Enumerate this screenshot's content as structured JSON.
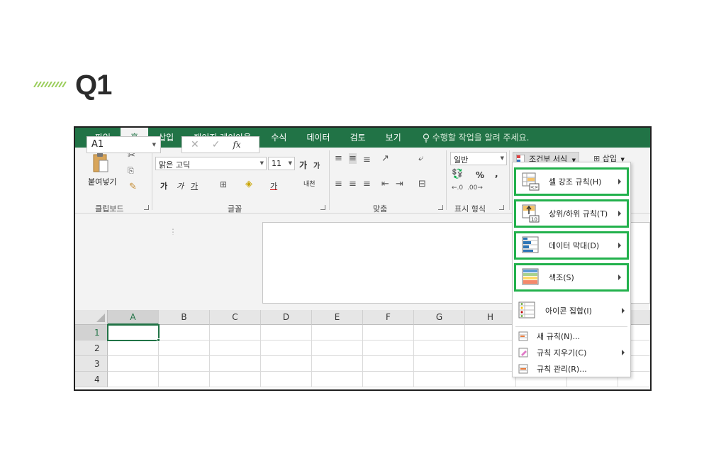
{
  "heading": {
    "title": "Q1"
  },
  "ribbon_tabs": [
    {
      "label": "파일"
    },
    {
      "label": "홈"
    },
    {
      "label": "삽입"
    },
    {
      "label": "페이지 레이아웃"
    },
    {
      "label": "수식"
    },
    {
      "label": "데이터"
    },
    {
      "label": "검토"
    },
    {
      "label": "보기"
    }
  ],
  "tell_me": "수행할 작업을 알려 주세요.",
  "clipboard": {
    "paste_label": "붙여넣기",
    "group_label": "클립보드"
  },
  "font": {
    "name": "맑은 고딕",
    "size": "11",
    "grow": "가",
    "shrink": "가",
    "bold": "가",
    "italic": "가",
    "underline": "가",
    "font_color": "가",
    "phonetic": "내천",
    "group_label": "글꼴"
  },
  "alignment": {
    "group_label": "맞춤"
  },
  "number": {
    "format": "일반",
    "percent": "%",
    "comma": ",",
    "group_label": "표시 형식"
  },
  "styles": {
    "conditional_formatting": "조건부 서식"
  },
  "cells": {
    "insert": "삽입"
  },
  "name_box": {
    "value": "A1"
  },
  "formula_bar": {
    "cancel": "✕",
    "enter": "✓",
    "fx": "fx"
  },
  "columns": [
    "A",
    "B",
    "C",
    "D",
    "E",
    "F",
    "G",
    "H"
  ],
  "rows": [
    "1",
    "2",
    "3",
    "4"
  ],
  "menu": {
    "items": [
      {
        "label": "셀 강조 규칙(H)",
        "highlighted": true,
        "submenu": true,
        "icon": "highlight-cells-rules-icon"
      },
      {
        "label": "상위/하위 규칙(T)",
        "highlighted": true,
        "submenu": true,
        "icon": "top-bottom-rules-icon",
        "icon_text": "10"
      },
      {
        "label": "데이터 막대(D)",
        "highlighted": true,
        "submenu": true,
        "icon": "data-bars-icon"
      },
      {
        "label": "색조(S)",
        "highlighted": true,
        "submenu": true,
        "icon": "color-scales-icon"
      },
      {
        "label": "아이콘 집합(I)",
        "highlighted": false,
        "submenu": true,
        "icon": "icon-sets-icon"
      }
    ],
    "small_items": [
      {
        "label": "새 규칙(N)...",
        "submenu": false,
        "icon": "new-rule-icon"
      },
      {
        "label": "규칙 지우기(C)",
        "submenu": true,
        "icon": "clear-rules-icon"
      },
      {
        "label": "규칙 관리(R)...",
        "submenu": false,
        "icon": "manage-rules-icon"
      }
    ],
    "highlight_color": "#22b14c"
  },
  "colors": {
    "excel_green": "#217346",
    "title_accent": "#9acd5a"
  }
}
